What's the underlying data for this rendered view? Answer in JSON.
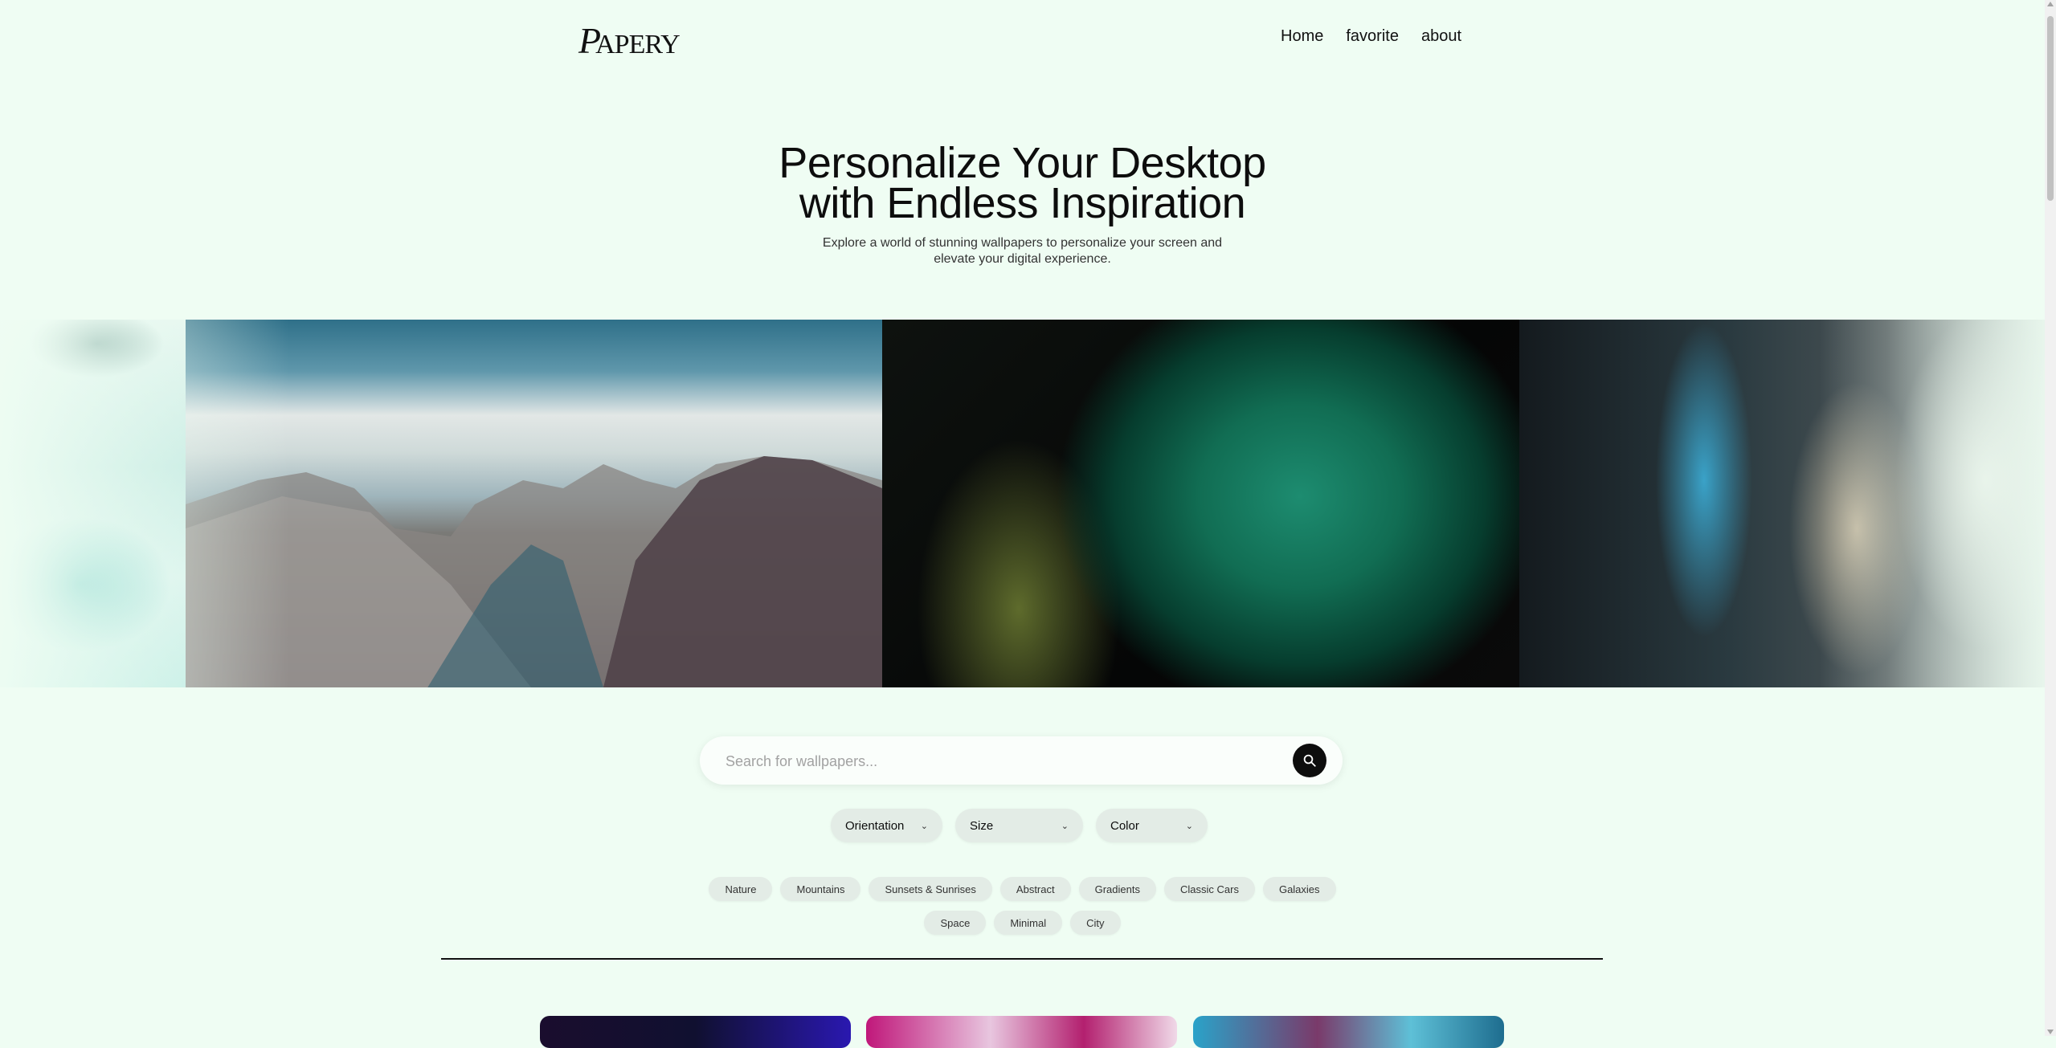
{
  "header": {
    "logo_initial": "P",
    "logo_rest": "APERY",
    "nav": [
      "Home",
      "favorite",
      "about"
    ]
  },
  "hero": {
    "title_line1": "Personalize Your Desktop",
    "title_line2": "with Endless Inspiration",
    "subtitle_line1": "Explore a world of stunning wallpapers to personalize your screen and",
    "subtitle_line2": "elevate your digital experience."
  },
  "search": {
    "placeholder": "Search for wallpapers..."
  },
  "filters": [
    {
      "label": "Orientation",
      "icon": "chevron-down-icon"
    },
    {
      "label": "Size",
      "icon": "chevron-down-icon"
    },
    {
      "label": "Color",
      "icon": "chevron-down-icon"
    }
  ],
  "tags": {
    "row1": [
      "Nature",
      "Mountains",
      "Sunsets & Sunrises",
      "Abstract",
      "Gradients",
      "Classic Cars",
      "Galaxies"
    ],
    "row2": [
      "Space",
      "Minimal",
      "City"
    ]
  },
  "colors": {
    "background": "#effdf3",
    "accent": "#0d0d0d",
    "chip": "#e3ece6"
  }
}
